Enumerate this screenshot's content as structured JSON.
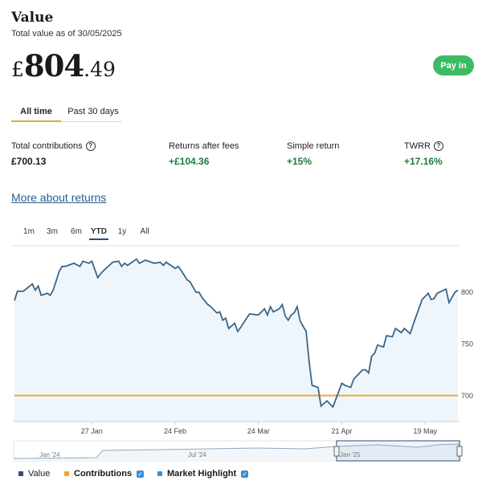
{
  "header": {
    "title": "Value",
    "subtitle": "Total value as of 30/05/2025",
    "currency": "£",
    "amount_int": "804",
    "amount_dec": ".49",
    "pay_in_label": "Pay in"
  },
  "period_tabs": [
    {
      "label": "All time",
      "active": true
    },
    {
      "label": "Past 30 days",
      "active": false
    }
  ],
  "stats": [
    {
      "label": "Total contributions",
      "value": "£700.13",
      "help": true
    },
    {
      "label": "Returns after fees",
      "value": "+£104.36",
      "help": false
    },
    {
      "label": "Simple return",
      "value": "+15%",
      "help": false
    },
    {
      "label": "TWRR",
      "value": "+17.16%",
      "help": true
    }
  ],
  "more_link": "More about returns",
  "range_tabs": [
    {
      "label": "1m",
      "active": false
    },
    {
      "label": "3m",
      "active": false
    },
    {
      "label": "6m",
      "active": false
    },
    {
      "label": "YTD",
      "active": true
    },
    {
      "label": "1y",
      "active": false
    },
    {
      "label": "All",
      "active": false
    }
  ],
  "navigator": {
    "labels": [
      "Jan '24",
      "Jul '24",
      "Jan '25"
    ]
  },
  "legend": [
    {
      "label": "Value",
      "color": "#2b4f7a",
      "checkbox": false
    },
    {
      "label": "Contributions",
      "color": "#f0a830",
      "checkbox": true
    },
    {
      "label": "Market Highlight",
      "color": "#3a8ed6",
      "checkbox": true
    }
  ],
  "colors": {
    "accent_green": "#3dbb63",
    "value_line": "#3d6585",
    "contribution_line": "#f0a830",
    "area_fill": "#eef6fc"
  },
  "chart_data": {
    "type": "area",
    "xlabel": "",
    "ylabel": "",
    "x_ticks": [
      "27 Jan",
      "24 Feb",
      "24 Mar",
      "21 Apr",
      "19 May"
    ],
    "y_ticks": [
      700,
      750,
      800
    ],
    "ylim": [
      675,
      845
    ],
    "xlim": [
      "2025-01-01",
      "2025-05-30"
    ],
    "grid": false,
    "series": [
      {
        "name": "Value",
        "x": [
          "2025-01-01",
          "2025-01-02",
          "2025-01-04",
          "2025-01-07",
          "2025-01-08",
          "2025-01-09",
          "2025-01-10",
          "2025-01-12",
          "2025-01-13",
          "2025-01-14",
          "2025-01-16",
          "2025-01-17",
          "2025-01-18",
          "2025-01-21",
          "2025-01-23",
          "2025-01-24",
          "2025-01-26",
          "2025-01-27",
          "2025-01-29",
          "2025-01-30",
          "2025-01-31",
          "2025-02-03",
          "2025-02-05",
          "2025-02-06",
          "2025-02-07",
          "2025-02-08",
          "2025-02-11",
          "2025-02-12",
          "2025-02-14",
          "2025-02-17",
          "2025-02-19",
          "2025-02-20",
          "2025-02-21",
          "2025-02-24",
          "2025-02-25",
          "2025-02-26",
          "2025-02-28",
          "2025-03-01",
          "2025-03-03",
          "2025-03-04",
          "2025-03-05",
          "2025-03-07",
          "2025-03-08",
          "2025-03-10",
          "2025-03-11",
          "2025-03-12",
          "2025-03-13",
          "2025-03-14",
          "2025-03-16",
          "2025-03-17",
          "2025-03-18",
          "2025-03-20",
          "2025-03-21",
          "2025-03-24",
          "2025-03-25",
          "2025-03-26",
          "2025-03-27",
          "2025-03-28",
          "2025-03-29",
          "2025-03-31",
          "2025-04-01",
          "2025-04-02",
          "2025-04-03",
          "2025-04-04",
          "2025-04-05",
          "2025-04-06",
          "2025-04-07",
          "2025-04-08",
          "2025-04-09",
          "2025-04-10",
          "2025-04-11",
          "2025-04-13",
          "2025-04-14",
          "2025-04-16",
          "2025-04-18",
          "2025-04-21",
          "2025-04-22",
          "2025-04-23",
          "2025-04-24",
          "2025-04-25",
          "2025-04-28",
          "2025-04-29",
          "2025-04-30",
          "2025-05-01",
          "2025-05-02",
          "2025-05-03",
          "2025-05-05",
          "2025-05-06",
          "2025-05-08",
          "2025-05-09",
          "2025-05-11",
          "2025-05-12",
          "2025-05-14",
          "2025-05-15",
          "2025-05-18",
          "2025-05-20",
          "2025-05-21",
          "2025-05-22",
          "2025-05-23",
          "2025-05-26",
          "2025-05-27",
          "2025-05-29",
          "2025-05-30"
        ],
        "values": [
          792,
          801,
          801,
          808,
          802,
          806,
          797,
          799,
          797,
          802,
          820,
          825,
          825,
          828,
          825,
          830,
          828,
          830,
          814,
          818,
          821,
          829,
          830,
          825,
          828,
          826,
          832,
          828,
          831,
          828,
          829,
          826,
          829,
          823,
          825,
          821,
          812,
          810,
          800,
          800,
          795,
          788,
          786,
          780,
          781,
          773,
          775,
          765,
          770,
          762,
          766,
          775,
          779,
          778,
          781,
          784,
          778,
          786,
          781,
          784,
          788,
          777,
          773,
          778,
          780,
          786,
          772,
          767,
          762,
          733,
          710,
          708,
          690,
          695,
          689,
          712,
          710,
          709,
          708,
          716,
          725,
          725,
          722,
          738,
          741,
          749,
          747,
          758,
          757,
          765,
          761,
          765,
          760,
          769,
          793,
          799,
          793,
          794,
          799,
          803,
          790,
          800,
          802
        ]
      },
      {
        "name": "Contributions",
        "x": [
          "2025-01-01",
          "2025-05-30"
        ],
        "values": [
          700.13,
          700.13
        ]
      }
    ]
  }
}
